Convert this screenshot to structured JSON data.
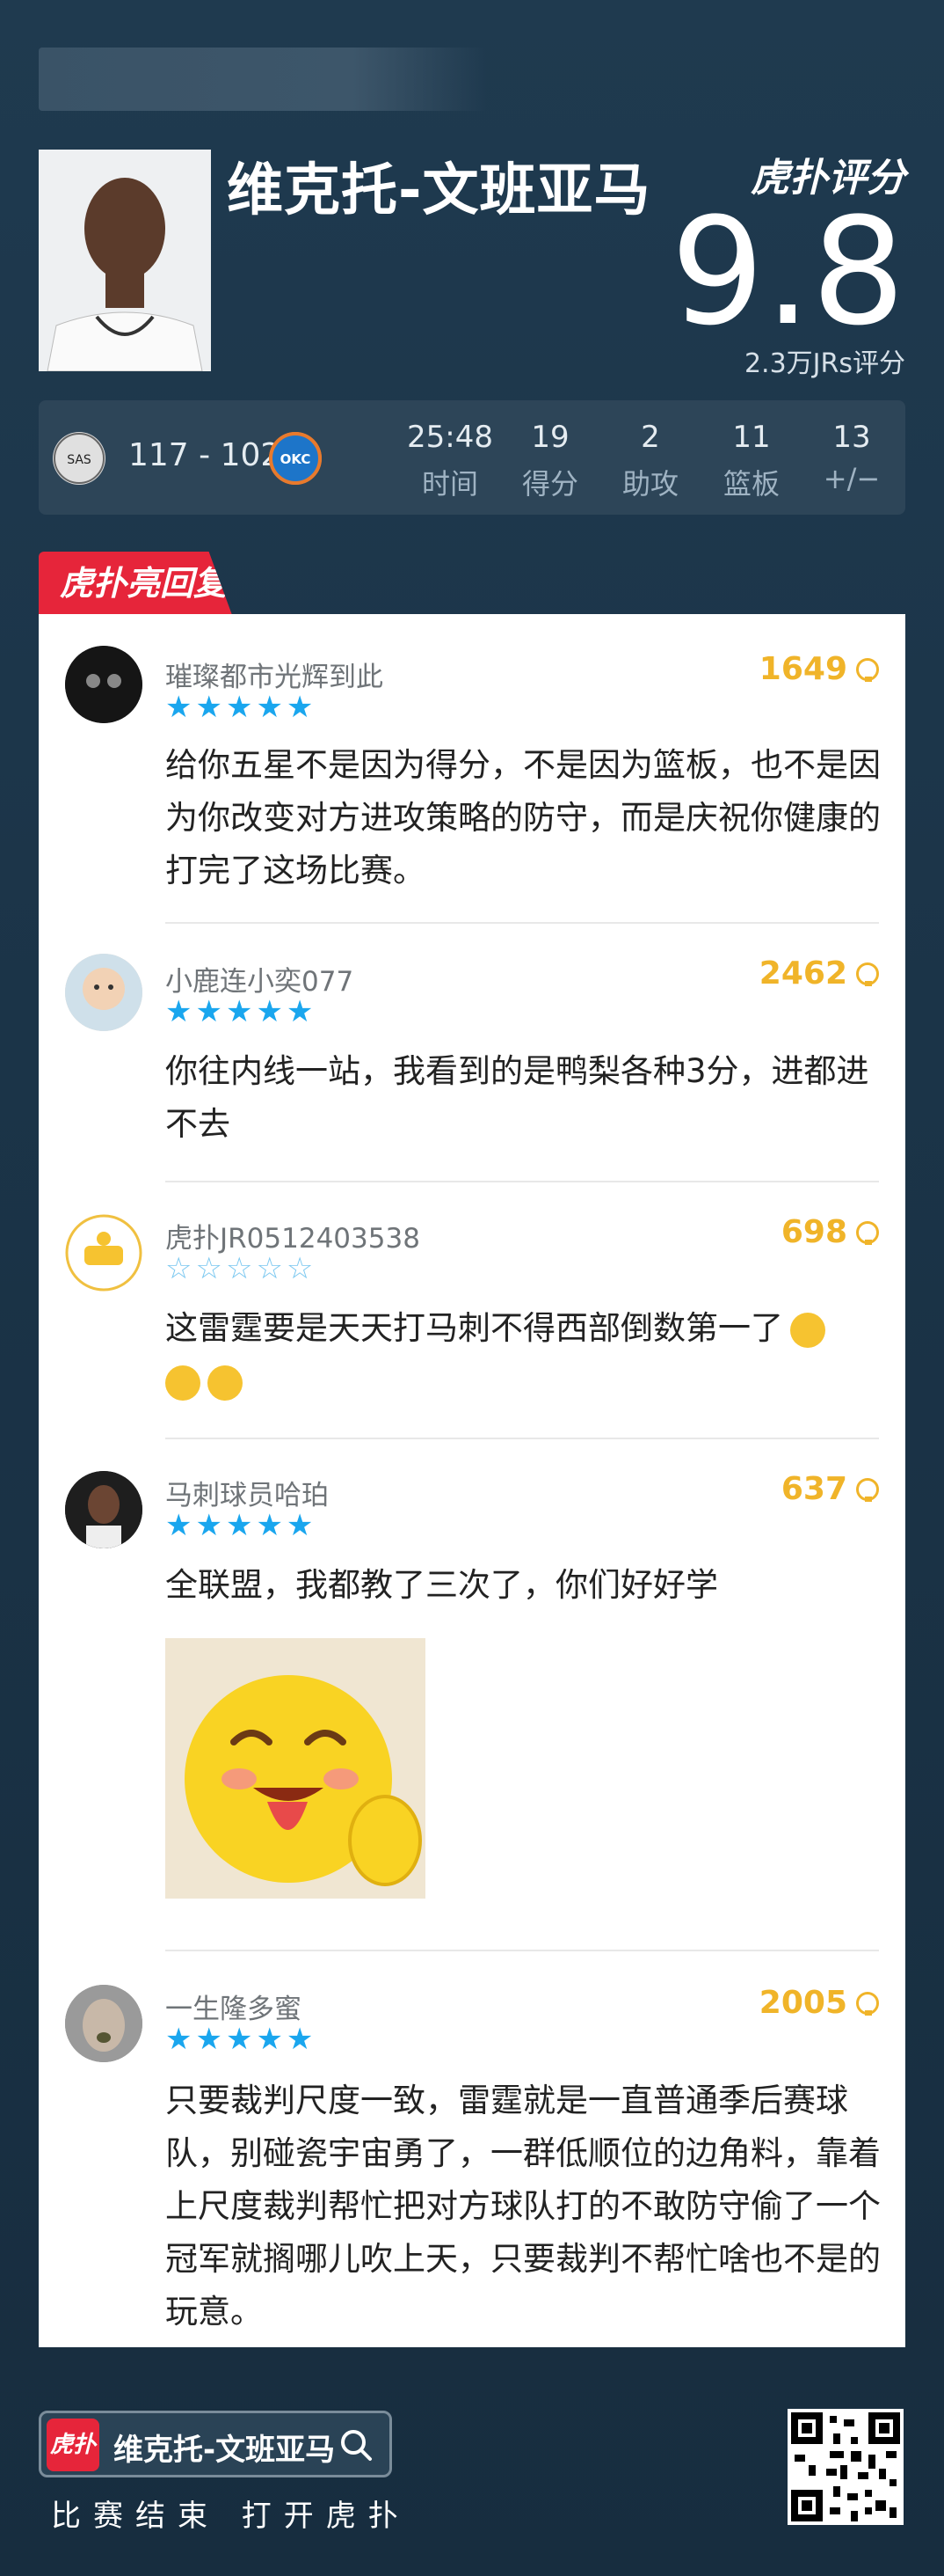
{
  "header": {
    "player_name": "维克托-文班亚马",
    "brand": "虎扑评分",
    "score": "9.8",
    "vote_count": "2.3万JRs评分"
  },
  "game": {
    "home_team": "SAS",
    "away_team": "OKC",
    "final_score": "117 - 102",
    "stats": [
      {
        "value": "25:48",
        "label": "时间"
      },
      {
        "value": "19",
        "label": "得分"
      },
      {
        "value": "2",
        "label": "助攻"
      },
      {
        "value": "11",
        "label": "篮板"
      },
      {
        "value": "13",
        "label": "+/−"
      }
    ]
  },
  "section_tag": "虎扑亮回复",
  "comments": [
    {
      "user": "璀璨都市光辉到此",
      "stars": 5,
      "stars_text": "★★★★★",
      "likes": "1649",
      "text": "给你五星不是因为得分，不是因为篮板，也不是因为你改变对方进攻策略的防守，而是庆祝你健康的打完了这场比赛。"
    },
    {
      "user": "小鹿连小奕077",
      "stars": 5,
      "stars_text": "★★★★★",
      "likes": "2462",
      "text": "你往内线一站，我看到的是鸭梨各种3分，进都进不去"
    },
    {
      "user": "虎扑JR0512403538",
      "stars": 0,
      "stars_text": "☆☆☆☆☆",
      "likes": "698",
      "text": "这雷霆要是天天打马刺不得西部倒数第一了"
    },
    {
      "user": "马刺球员哈珀",
      "stars": 5,
      "stars_text": "★★★★★",
      "likes": "637",
      "text": "全联盟，我都教了三次了，你们好好学"
    },
    {
      "user": "一生隆多蜜",
      "stars": 5,
      "stars_text": "★★★★★",
      "likes": "2005",
      "text": "只要裁判尺度一致，雷霆就是一直普通季后赛球队，别碰瓷宇宙勇了，一群低顺位的边角料，靠着上尺度裁判帮忙把对方球队打的不敢防守偷了一个冠军就搁哪儿吹上天，只要裁判不帮忙啥也不是的玩意。"
    }
  ],
  "footer": {
    "search_label": "维克托-文班亚马",
    "logo_text": "虎扑",
    "cta": "比赛结束 打开虎扑"
  },
  "colors": {
    "accent_red": "#e6253a",
    "like_gold": "#f0b429",
    "star_blue": "#1aa6ee"
  }
}
